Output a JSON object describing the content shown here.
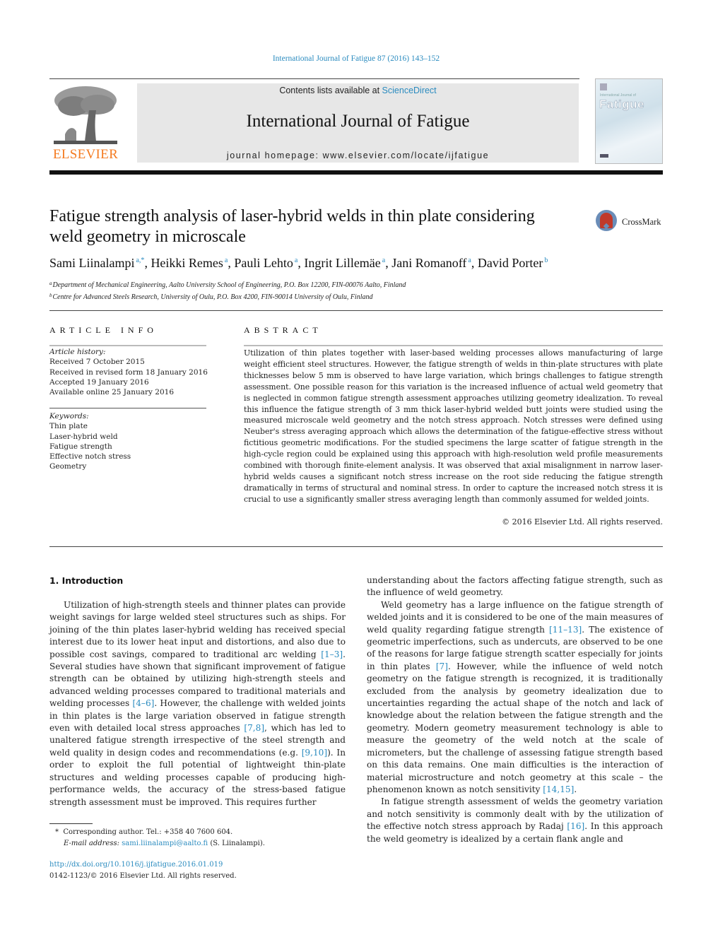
{
  "header": {
    "citation": "International Journal of Fatigue 87 (2016) 143–152",
    "contents_prefix": "Contents lists available at ",
    "contents_link": "ScienceDirect",
    "journal_name": "International Journal of Fatigue",
    "homepage": "journal homepage: www.elsevier.com/locate/ijfatigue",
    "publisher_logo_text": "ELSEVIER",
    "cover_small_text": "International Journal of",
    "cover_title": "Fatigue",
    "brand_color": "#f47a20",
    "link_color": "#2a8bbf"
  },
  "article": {
    "title_line1": "Fatigue strength analysis of laser-hybrid welds in thin plate considering",
    "title_line2": "weld geometry in microscale",
    "crossmark_label": "CrossMark",
    "authors": [
      {
        "name": "Sami Liinalampi",
        "aff": "a,*"
      },
      {
        "name": "Heikki Remes",
        "aff": "a"
      },
      {
        "name": "Pauli Lehto",
        "aff": "a"
      },
      {
        "name": "Ingrit Lillemäe",
        "aff": "a"
      },
      {
        "name": "Jani Romanoff",
        "aff": "a"
      },
      {
        "name": "David Porter",
        "aff": "b"
      }
    ],
    "affiliations": [
      {
        "key": "a",
        "text": "Department of Mechanical Engineering, Aalto University School of Engineering, P.O. Box 12200, FIN-00076 Aalto, Finland"
      },
      {
        "key": "b",
        "text": "Centre for Advanced Steels Research, University of Oulu, P.O. Box 4200, FIN-90014 University of Oulu, Finland"
      }
    ]
  },
  "article_info": {
    "heading": "ARTICLE INFO",
    "history_label": "Article history:",
    "history": [
      "Received 7 October 2015",
      "Received in revised form 18 January 2016",
      "Accepted 19 January 2016",
      "Available online 25 January 2016"
    ],
    "keywords_label": "Keywords:",
    "keywords": [
      "Thin plate",
      "Laser-hybrid weld",
      "Fatigue strength",
      "Effective notch stress",
      "Geometry"
    ]
  },
  "abstract": {
    "heading": "ABSTRACT",
    "text": "Utilization of thin plates together with laser-based welding processes allows manufacturing of large weight efficient steel structures. However, the fatigue strength of welds in thin-plate structures with plate thicknesses below 5 mm is observed to have large variation, which brings challenges to fatigue strength assessment. One possible reason for this variation is the increased influence of actual weld geometry that is neglected in common fatigue strength assessment approaches utilizing geometry idealization. To reveal this influence the fatigue strength of 3 mm thick laser-hybrid welded butt joints were studied using the measured microscale weld geometry and the notch stress approach. Notch stresses were defined using Neuber's stress averaging approach which allows the determination of the fatigue-effective stress without fictitious geometric modifications. For the studied specimens the large scatter of fatigue strength in the high-cycle region could be explained using this approach with high-resolution weld profile measurements combined with thorough finite-element analysis. It was observed that axial misalignment in narrow laser-hybrid welds causes a significant notch stress increase on the root side reducing the fatigue strength dramatically in terms of structural and nominal stress. In order to capture the increased notch stress it is crucial to use a significantly smaller stress averaging length than commonly assumed for welded joints.",
    "copyright": "© 2016 Elsevier Ltd. All rights reserved."
  },
  "body": {
    "section_heading": "1. Introduction",
    "left": {
      "p1_a": "Utilization of high-strength steels and thinner plates can provide weight savings for large welded steel structures such as ships. For joining of the thin plates laser-hybrid welding has received special interest due to its lower heat input and distortions, and also due to possible cost savings, compared to traditional arc welding ",
      "ref1": "[1–3]",
      "p1_b": ". Several studies have shown that significant improvement of fatigue strength can be obtained by utilizing high-strength steels and advanced welding processes compared to traditional materials and welding processes ",
      "ref2": "[4–6]",
      "p1_c": ". However, the challenge with welded joints in thin plates is the large variation observed in fatigue strength even with detailed local stress approaches ",
      "ref3": "[7,8]",
      "p1_d": ", which has led to unaltered fatigue strength irrespective of the steel strength and weld quality in design codes and recommendations (e.g. ",
      "ref4": "[9,10]",
      "p1_e": "). In order to exploit the full potential of lightweight thin-plate structures and welding processes capable of producing high-performance welds, the accuracy of the stress-based fatigue strength assessment must be improved. This requires further"
    },
    "right": {
      "p1_cont": "understanding about the factors affecting fatigue strength, such as the influence of weld geometry.",
      "p2_a": "Weld geometry has a large influence on the fatigue strength of welded joints and it is considered to be one of the main measures of weld quality regarding fatigue strength ",
      "ref5": "[11–13]",
      "p2_b": ". The existence of geometric imperfections, such as undercuts, are observed to be one of the reasons for large fatigue strength scatter especially for joints in thin plates ",
      "ref6": "[7]",
      "p2_c": ". However, while the influence of weld notch geometry on the fatigue strength is recognized, it is traditionally excluded from the analysis by geometry idealization due to uncertainties regarding the actual shape of the notch and lack of knowledge about the relation between the fatigue strength and the geometry. Modern geometry measurement technology is able to measure the geometry of the weld notch at the scale of micrometers, but the challenge of assessing fatigue strength based on this data remains. One main difficulties is the interaction of material microstructure and notch geometry at this scale – the phenomenon known as notch sensitivity ",
      "ref7": "[14,15]",
      "p2_d": ".",
      "p3_a": "In fatigue strength assessment of welds the geometry variation and notch sensitivity is commonly dealt with by the utilization of the effective notch stress approach by Radaj ",
      "ref8": "[16]",
      "p3_b": ". In this approach the weld geometry is idealized by a certain flank angle and"
    }
  },
  "footnotes": {
    "star": "*",
    "corresponding": "Corresponding author. Tel.: +358 40 7600 604.",
    "email_label": "E-mail address:",
    "email": "sami.liinalampi@aalto.fi",
    "email_suffix": " (S. Liinalampi).",
    "doi": "http://dx.doi.org/10.1016/j.ijfatigue.2016.01.019",
    "issn_line": "0142-1123/© 2016 Elsevier Ltd. All rights reserved."
  }
}
